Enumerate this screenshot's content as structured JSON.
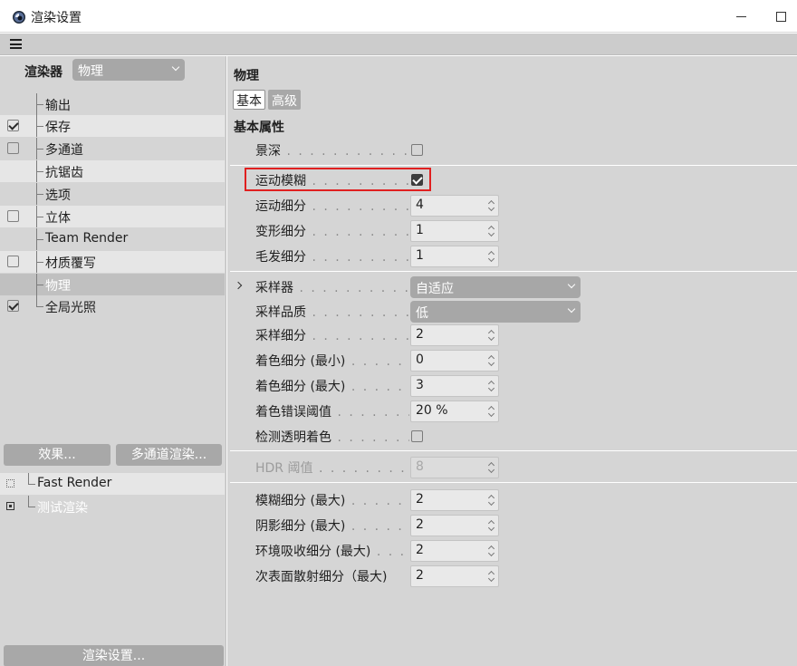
{
  "window": {
    "title": "渲染设置"
  },
  "left": {
    "renderer_label": "渲染器",
    "renderer_value": "物理",
    "items": [
      {
        "label": "输出",
        "check": null
      },
      {
        "label": "保存",
        "check": true
      },
      {
        "label": "多通道",
        "check": false
      },
      {
        "label": "抗锯齿",
        "check": null
      },
      {
        "label": "选项",
        "check": null
      },
      {
        "label": "立体",
        "check": false
      },
      {
        "label": "Team Render",
        "check": null
      },
      {
        "label": "材质覆写",
        "check": false
      },
      {
        "label": "物理",
        "check": null,
        "selected": true
      },
      {
        "label": "全局光照",
        "check": true
      }
    ],
    "effects_button": "效果...",
    "multipass_button": "多通道渲染...",
    "presets": [
      {
        "label": "Fast Render",
        "active": false
      },
      {
        "label": "测试渲染",
        "active": true
      }
    ],
    "render_settings_button": "渲染设置..."
  },
  "right": {
    "section_title": "物理",
    "tabs": {
      "basic": "基本",
      "advanced": "高级"
    },
    "basic_props_label": "基本属性",
    "depth_of_field": {
      "label": "景深",
      "checked": false
    },
    "motion_blur": {
      "label": "运动模糊",
      "checked": true
    },
    "motion_subdiv": {
      "label": "运动细分",
      "value": "4"
    },
    "deform_subdiv": {
      "label": "变形细分",
      "value": "1"
    },
    "hair_subdiv": {
      "label": "毛发细分",
      "value": "1"
    },
    "sampler": {
      "label": "采样器",
      "value": "自适应"
    },
    "sampling_quality": {
      "label": "采样品质",
      "value": "低"
    },
    "sampling_subdiv": {
      "label": "采样细分",
      "value": "2"
    },
    "shading_subdiv_min": {
      "label": "着色细分 (最小)",
      "value": "0"
    },
    "shading_subdiv_max": {
      "label": "着色细分 (最大)",
      "value": "3"
    },
    "shading_error_threshold": {
      "label": "着色错误阈值",
      "value": "20 %"
    },
    "detect_transparent_shading": {
      "label": "检测透明着色",
      "checked": false
    },
    "hdr_threshold": {
      "label": "HDR 阈值",
      "value": "8"
    },
    "blur_subdiv_max": {
      "label": "模糊细分 (最大)",
      "value": "2"
    },
    "shadow_subdiv_max": {
      "label": "阴影细分 (最大)",
      "value": "2"
    },
    "ao_subdiv_max": {
      "label": "环境吸收细分 (最大)",
      "value": "2"
    },
    "sss_subdiv_max": {
      "label": "次表面散射细分（最大)",
      "value": "2"
    }
  },
  "colors": {
    "highlight_box": "#e02020",
    "panel": "#d5d5d5",
    "button": "#a8a8a8"
  }
}
